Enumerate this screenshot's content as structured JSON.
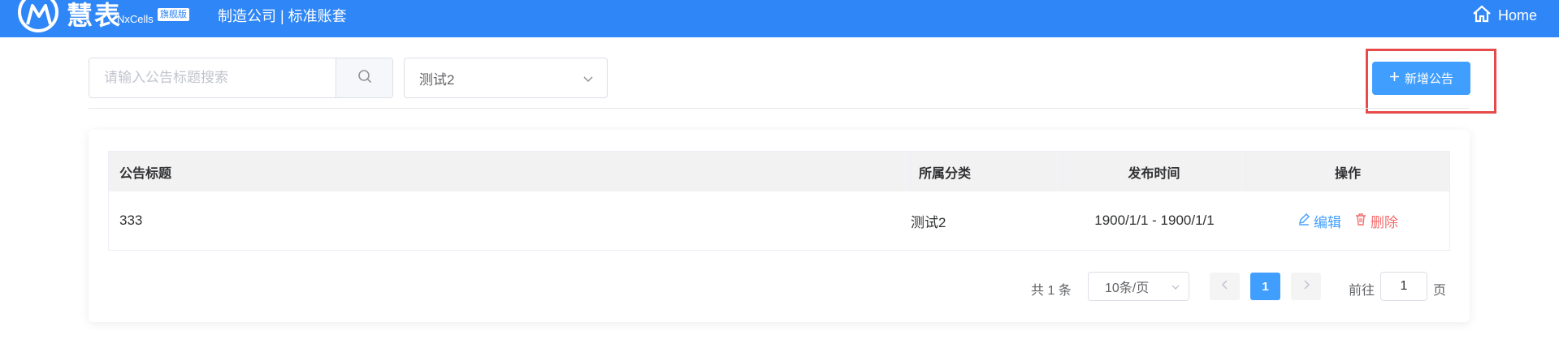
{
  "header": {
    "brand": "慧表",
    "brand_sub": "NxCells",
    "edition_badge": "旗舰版",
    "company": "制造公司 | 标准账套",
    "home_label": "Home"
  },
  "toolbar": {
    "search_placeholder": "请输入公告标题搜索",
    "search_value": "",
    "category_value": "测试2",
    "add_button": "新增公告"
  },
  "table": {
    "columns": [
      "公告标题",
      "所属分类",
      "发布时间",
      "操作"
    ],
    "rows": [
      {
        "title": "333",
        "category": "测试2",
        "time": "1900/1/1 - 1900/1/1",
        "edit": "编辑",
        "delete": "删除"
      }
    ]
  },
  "pagination": {
    "total_text": "共 1 条",
    "page_size": "10条/页",
    "current_page": "1",
    "goto_label": "前往",
    "goto_value": "1",
    "goto_unit": "页"
  },
  "colors": {
    "header_bg": "#2f86f6",
    "primary": "#409eff",
    "danger": "#f56c6c",
    "highlight_outline": "#e64a4a"
  }
}
